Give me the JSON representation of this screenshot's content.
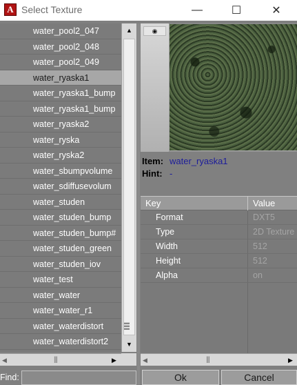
{
  "window": {
    "title": "Select Texture",
    "icon_letter": "A",
    "controls": {
      "minimize": "—",
      "maximize": "☐",
      "close": "✕"
    }
  },
  "texture_list": {
    "selected_index": 3,
    "items": [
      "water_pool2_047",
      "water_pool2_048",
      "water_pool2_049",
      "water_ryaska1",
      "water_ryaska1_bump",
      "water_ryaska1_bump",
      "water_ryaska2",
      "water_ryska",
      "water_ryska2",
      "water_sbumpvolume",
      "water_sdiffusevolum",
      "water_studen",
      "water_studen_bump",
      "water_studen_bump#",
      "water_studen_green",
      "water_studen_iov",
      "water_test",
      "water_water",
      "water_water_r1",
      "water_waterdistort",
      "water_waterdistort2"
    ]
  },
  "find": {
    "label": "Find:",
    "value": ""
  },
  "preview": {
    "eye_icon": "eye-icon"
  },
  "info": {
    "item_label": "Item:",
    "item_value": "water_ryaska1",
    "hint_label": "Hint:",
    "hint_value": "-"
  },
  "properties": {
    "header_key": "Key",
    "header_value": "Value",
    "rows": [
      {
        "key": "Format",
        "value": "DXT5"
      },
      {
        "key": "Type",
        "value": "2D Texture"
      },
      {
        "key": "Width",
        "value": "512"
      },
      {
        "key": "Height",
        "value": "512"
      },
      {
        "key": "Alpha",
        "value": "on"
      }
    ]
  },
  "buttons": {
    "ok": "Ok",
    "cancel": "Cancel"
  }
}
